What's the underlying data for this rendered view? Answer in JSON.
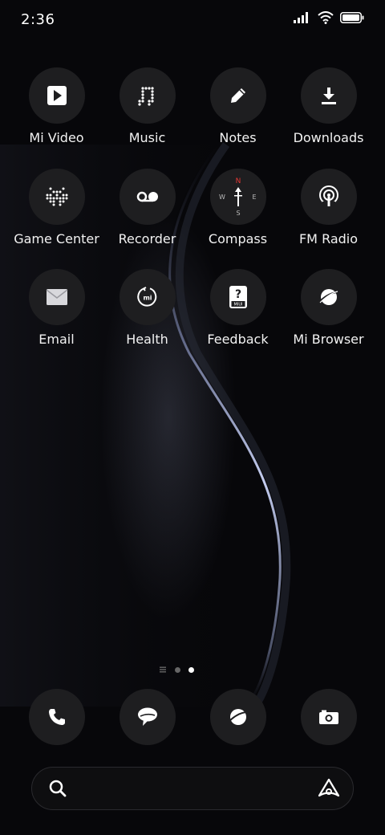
{
  "status_bar": {
    "time": "2:36",
    "icons": [
      "signal-icon",
      "wifi-icon",
      "battery-icon"
    ]
  },
  "apps": [
    {
      "label": "Mi Video",
      "icon": "play-icon"
    },
    {
      "label": "Music",
      "icon": "music-note-icon"
    },
    {
      "label": "Notes",
      "icon": "pencil-icon"
    },
    {
      "label": "Downloads",
      "icon": "download-icon"
    },
    {
      "label": "Game Center",
      "icon": "game-invader-icon"
    },
    {
      "label": "Recorder",
      "icon": "voicemail-icon"
    },
    {
      "label": "Compass",
      "icon": "compass-icon",
      "directions": [
        "N",
        "W",
        "E",
        "S"
      ]
    },
    {
      "label": "FM Radio",
      "icon": "radio-broadcast-icon"
    },
    {
      "label": "Email",
      "icon": "envelope-icon"
    },
    {
      "label": "Health",
      "icon": "mi-health-icon",
      "badge_text": "mi"
    },
    {
      "label": "Feedback",
      "icon": "feedback-icon",
      "badge_text": "MIUI"
    },
    {
      "label": "Mi Browser",
      "icon": "browser-planet-icon"
    }
  ],
  "dock": [
    {
      "name": "phone",
      "icon": "phone-icon"
    },
    {
      "name": "messages",
      "icon": "chat-bubble-icon"
    },
    {
      "name": "browser",
      "icon": "browser-planet-icon"
    },
    {
      "name": "camera",
      "icon": "camera-icon"
    }
  ],
  "page_indicator": {
    "pages": 2,
    "active_index": 1
  },
  "search": {
    "icon": "search-icon",
    "assistant_icon": "assistant-icon"
  },
  "colors": {
    "icon_bg": "#1e1e20",
    "compass_north": "#e53935",
    "wallpaper_curve": "#aeb8e0"
  }
}
